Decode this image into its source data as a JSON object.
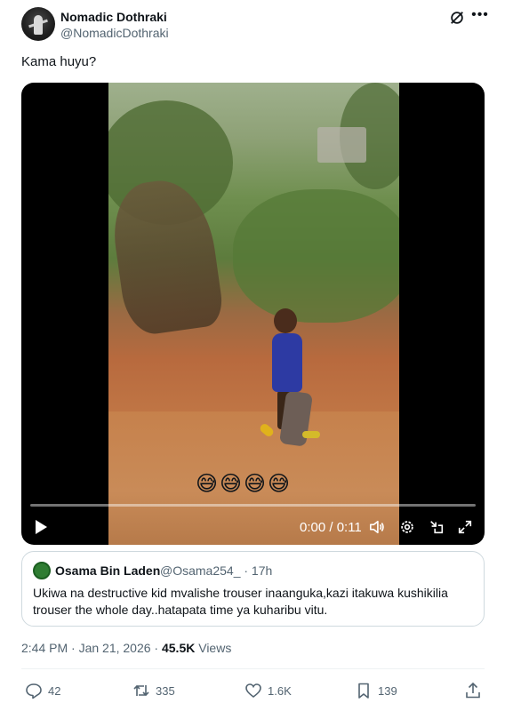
{
  "author": {
    "name": "Nomadic Dothraki",
    "handle": "@NomadicDothraki"
  },
  "tweet": {
    "text": "Kama huyu?"
  },
  "video": {
    "emojis": "😅😅😅😅",
    "time": "0:00 / 0:11",
    "progress": 0
  },
  "quote": {
    "name": "Osama Bin Laden",
    "handle_time": "@Osama254_ · 17h",
    "text": "Ukiwa na destructive kid mvalishe trouser inaanguka,kazi itakuwa kushikilia trouser the whole day..hatapata time ya kuharibu vitu."
  },
  "meta": {
    "timestamp": "2:44 PM · Jan 21, 2026 · ",
    "views_count": "45.5K",
    "views_label": " Views"
  },
  "actions": {
    "replies": "42",
    "reposts": "335",
    "likes": "1.6K",
    "bookmarks": "139"
  },
  "icons": [
    "grok-icon",
    "more-icon",
    "play-icon",
    "volume-icon",
    "settings-icon",
    "minimize-icon",
    "fullscreen-icon",
    "reply-icon",
    "repost-icon",
    "like-icon",
    "bookmark-icon",
    "share-icon"
  ]
}
